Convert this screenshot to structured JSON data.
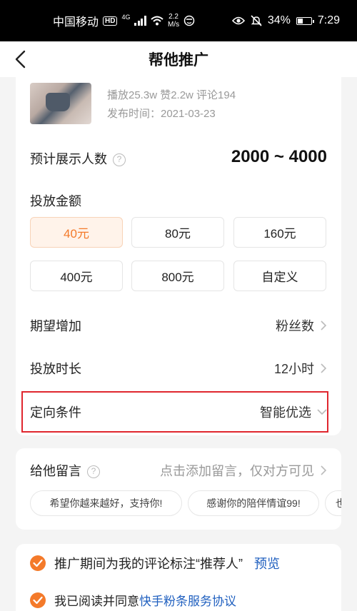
{
  "status_bar": {
    "carrier": "中国移动",
    "hd": "HD",
    "network": "4G",
    "speed_value": "2.2",
    "speed_unit": "M/s",
    "battery": "34%",
    "time": "7:29"
  },
  "header": {
    "title": "帮他推广",
    "back_icon": "chevron-left-icon"
  },
  "video": {
    "stats": "播放25.3w  赞2.2w  评论194",
    "publish_date": "发布时间：2021-03-23"
  },
  "audience": {
    "label": "预计展示人数",
    "help_icon": "question-circle-icon",
    "range": "2000 ~ 4000"
  },
  "amount": {
    "label": "投放金额",
    "options": [
      "40元",
      "80元",
      "160元",
      "400元",
      "800元",
      "自定义"
    ],
    "selected": "40元"
  },
  "settings": [
    {
      "label": "期望增加",
      "value": "粉丝数",
      "icon": "chevron-right-icon"
    },
    {
      "label": "投放时长",
      "value": "12小时",
      "icon": "chevron-right-icon"
    },
    {
      "label": "定向条件",
      "value": "智能优选",
      "icon": "chevron-down-icon"
    }
  ],
  "message": {
    "label": "给他留言",
    "help_icon": "question-circle-icon",
    "hint": "点击添加留言，仅对方可见",
    "chips": [
      "希望你越来越好，支持你!",
      "感谢你的陪伴情谊99!",
      "也"
    ]
  },
  "agreements": {
    "comment_tag": "推广期间为我的评论标注“推荐人”",
    "preview": "预览",
    "agree_prefix": "我已阅读并同意",
    "agree_link": "快手粉条服务协议"
  },
  "colors": {
    "accent": "#f47a2a",
    "link": "#1f5fbf",
    "highlight": "#e0262e"
  }
}
